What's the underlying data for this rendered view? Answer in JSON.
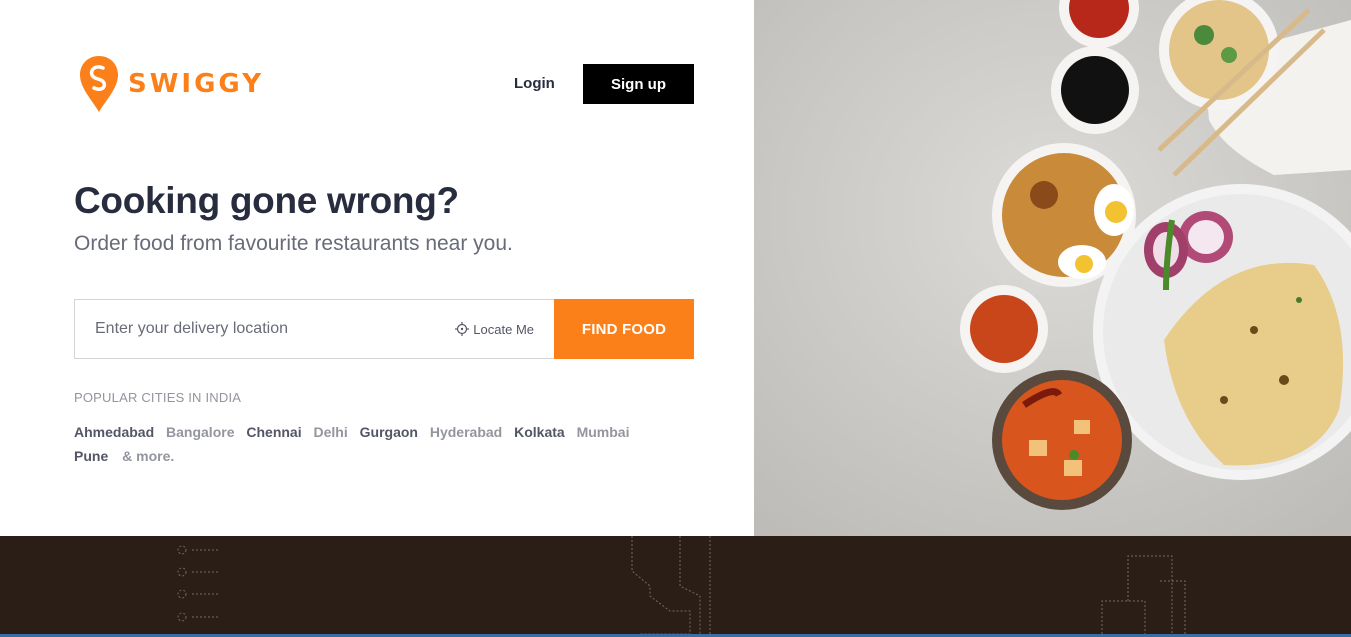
{
  "brand": {
    "name": "SWIGGY",
    "color": "#fc8019"
  },
  "header": {
    "login_label": "Login",
    "signup_label": "Sign up"
  },
  "hero": {
    "title": "Cooking gone wrong?",
    "subtitle": "Order food from favourite restaurants near you."
  },
  "search": {
    "placeholder": "Enter your delivery location",
    "value": "",
    "locate_label": "Locate Me",
    "find_label": "FIND FOOD"
  },
  "popular": {
    "title": "POPULAR CITIES IN INDIA",
    "cities": [
      "Ahmedabad",
      "Bangalore",
      "Chennai",
      "Delhi",
      "Gurgaon",
      "Hyderabad",
      "Kolkata",
      "Mumbai",
      "Pune"
    ],
    "more_label": "& more."
  },
  "icons": {
    "logo": "swiggy-logo-icon",
    "locate": "crosshair-icon"
  }
}
